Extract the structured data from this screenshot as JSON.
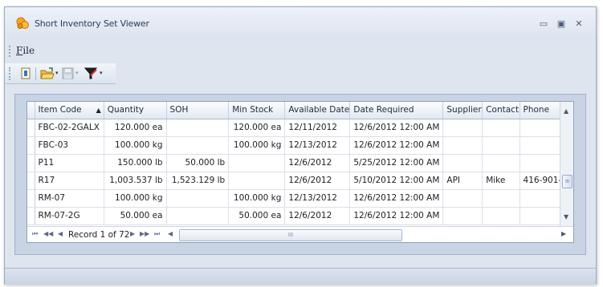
{
  "window": {
    "title": "Short Inventory Set Viewer",
    "icons": {
      "app": "app-icon",
      "minimize": "minimize-icon",
      "maximize": "maximize-icon",
      "close": "close-icon"
    },
    "minimize_glyph": "▭",
    "maximize_glyph": "▣",
    "close_glyph": "✕"
  },
  "menu": {
    "file_label": "File"
  },
  "toolbar": {
    "icons": [
      "info-icon",
      "open-folder-icon",
      "save-icon",
      "filter-icon"
    ]
  },
  "grid": {
    "columns": [
      "Item Code",
      "Quantity",
      "SOH",
      "Min Stock",
      "Available Date",
      "Date Required",
      "Supplier",
      "Contact",
      "Phone"
    ],
    "sort_indicator": "▲",
    "rows": [
      [
        "FBC-02-2GALX",
        "120.000 ea",
        "",
        "120.000 ea",
        "12/11/2012",
        "12/6/2012 12:00 AM",
        "",
        "",
        ""
      ],
      [
        "FBC-03",
        "100.000 kg",
        "",
        "100.000 kg",
        "12/13/2012",
        "12/6/2012 12:00 AM",
        "",
        "",
        ""
      ],
      [
        "P11",
        "150.000 lb",
        "50.000 lb",
        "",
        "12/6/2012",
        "5/25/2012 12:00 AM",
        "",
        "",
        ""
      ],
      [
        "R17",
        "1,003.537 lb",
        "1,523.129 lb",
        "",
        "12/6/2012",
        "5/10/2012 12:00 AM",
        "API",
        "Mike",
        "416-901-"
      ],
      [
        "RM-07",
        "100.000 kg",
        "",
        "100.000 kg",
        "12/13/2012",
        "12/6/2012 12:00 AM",
        "",
        "",
        ""
      ],
      [
        "RM-07-2G",
        "50.000 ea",
        "",
        "50.000 ea",
        "12/6/2012",
        "12/6/2012 12:00 AM",
        "",
        "",
        ""
      ]
    ],
    "navigator": {
      "record_text": "Record 1 of 72",
      "first": "⏮",
      "prev_page": "◀◀",
      "prev": "◀",
      "next": "▶",
      "next_page": "▶▶",
      "last": "⏭",
      "scroll_left": "◀"
    },
    "hscroll_grip": "III",
    "vscroll_grip": "≡",
    "scroll_up": "▲",
    "scroll_down": "▼",
    "scroll_right": "▶"
  },
  "colors": {
    "accent": "#f29a1f",
    "border": "#9aa9c2",
    "header": "#e3e9f2"
  }
}
